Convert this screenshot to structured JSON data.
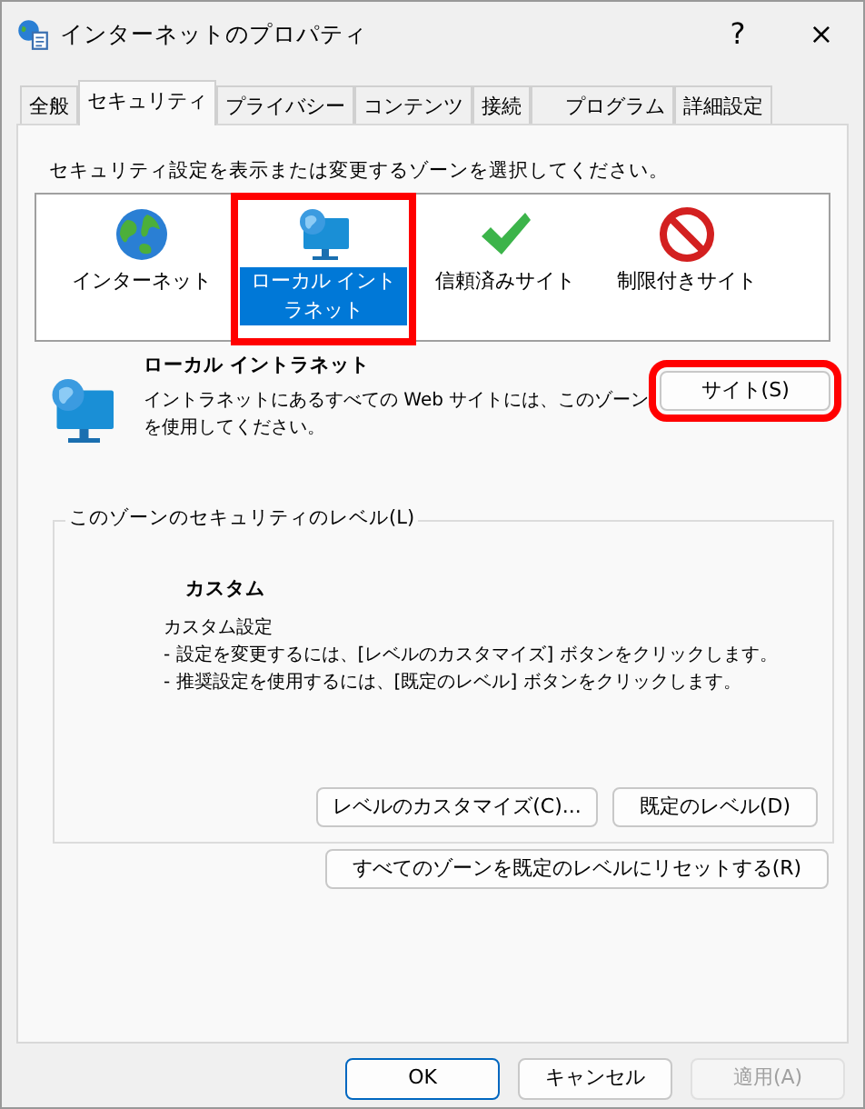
{
  "window": {
    "title": "インターネットのプロパティ",
    "help": "?",
    "close": "×"
  },
  "tabs": [
    {
      "label": "全般",
      "selected": false
    },
    {
      "label": "セキュリティ",
      "selected": true
    },
    {
      "label": "プライバシー",
      "selected": false
    },
    {
      "label": "コンテンツ",
      "selected": false
    },
    {
      "label": "接続",
      "selected": false
    },
    {
      "label": "プログラム",
      "selected": false
    },
    {
      "label": "詳細設定",
      "selected": false
    }
  ],
  "zone_prompt": "セキュリティ設定を表示または変更するゾーンを選択してください。",
  "zones": [
    {
      "kind": "globe",
      "label": "インターネット",
      "selected": false,
      "highlighted": false
    },
    {
      "kind": "monitor",
      "label": "ローカル イントラネット",
      "selected": true,
      "highlighted": true
    },
    {
      "kind": "check",
      "label": "信頼済みサイト",
      "selected": false,
      "highlighted": false
    },
    {
      "kind": "block",
      "label": "制限付きサイト",
      "selected": false,
      "highlighted": false
    }
  ],
  "zone_info": {
    "title": "ローカル イントラネット",
    "description_lines": [
      "イントラネットにあるすべての Web サイトには、このゾーン",
      "を使用してください。"
    ],
    "button": {
      "label": "サイト(S)",
      "highlighted": true
    }
  },
  "security_level": {
    "legend": "このゾーンのセキュリティのレベル(L)",
    "level_name": "カスタム",
    "details": [
      "カスタム設定",
      "- 設定を変更するには、[レベルのカスタマイズ] ボタンをクリックします。",
      "- 推奨設定を使用するには、[既定のレベル] ボタンをクリックします。"
    ],
    "buttons": [
      "レベルのカスタマイズ(C)...",
      "既定のレベル(D)"
    ]
  },
  "reset_button": "すべてのゾーンを既定のレベルにリセットする(R)",
  "footer_buttons": [
    {
      "label": "OK",
      "default": true,
      "disabled": false
    },
    {
      "label": "キャンセル",
      "default": false,
      "disabled": false
    },
    {
      "label": "適用(A)",
      "default": false,
      "disabled": true
    }
  ]
}
